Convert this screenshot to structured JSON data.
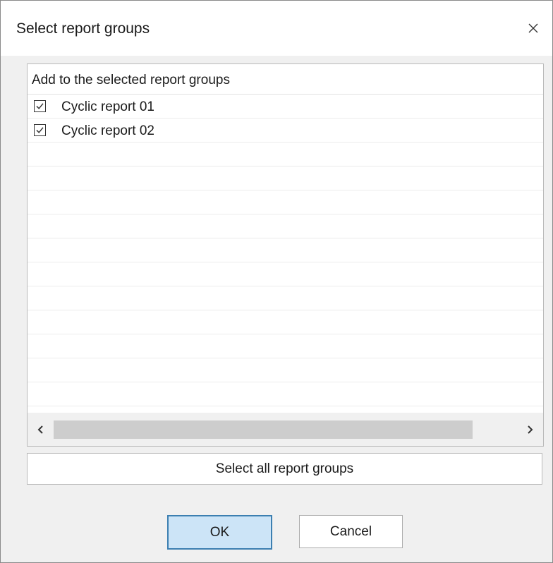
{
  "dialog": {
    "title": "Select report groups",
    "close_icon": "close-icon"
  },
  "list": {
    "header": "Add to the selected report groups",
    "items": [
      {
        "label": "Cyclic report 01",
        "checked": true
      },
      {
        "label": "Cyclic report 02",
        "checked": true
      }
    ]
  },
  "scrollbar": {
    "left_icon": "chevron-left-icon",
    "right_icon": "chevron-right-icon"
  },
  "buttons": {
    "select_all": "Select all report groups",
    "ok": "OK",
    "cancel": "Cancel"
  },
  "colors": {
    "ok_background": "#cce4f7",
    "ok_border": "#3c7fb1",
    "dialog_background": "#f0f0f0"
  }
}
